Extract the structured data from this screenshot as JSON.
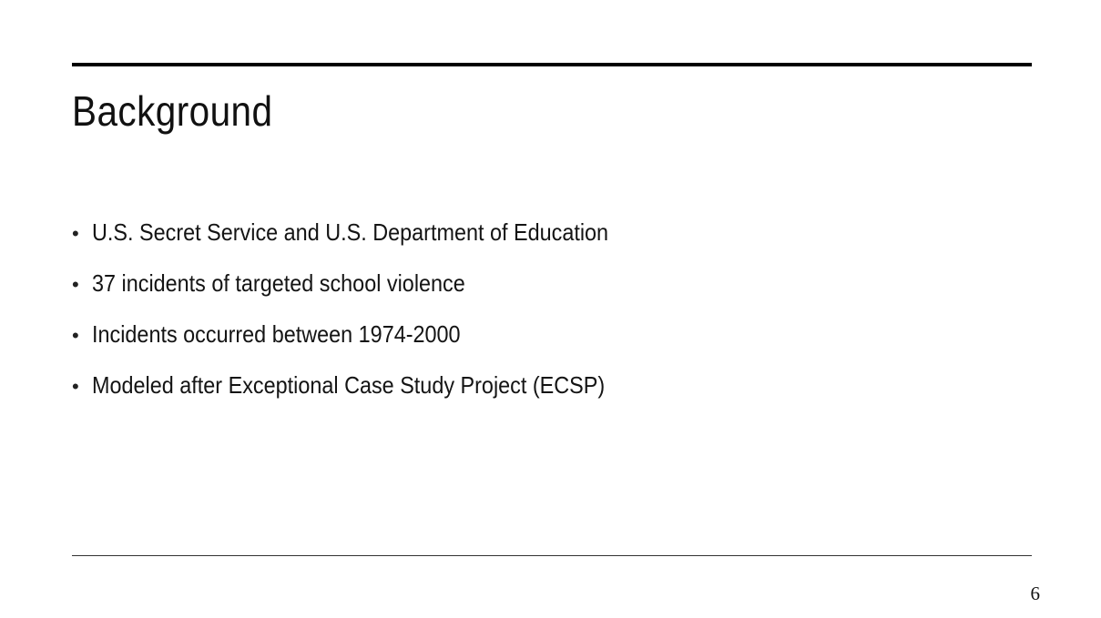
{
  "slide": {
    "title": "Background",
    "bullet_symbol": "•",
    "bullets": [
      "U.S. Secret Service and U.S. Department of Education",
      "37 incidents of targeted school violence",
      "Incidents occurred between 1974-2000",
      "Modeled after Exceptional Case Study Project (ECSP)"
    ],
    "page_number": "6"
  }
}
